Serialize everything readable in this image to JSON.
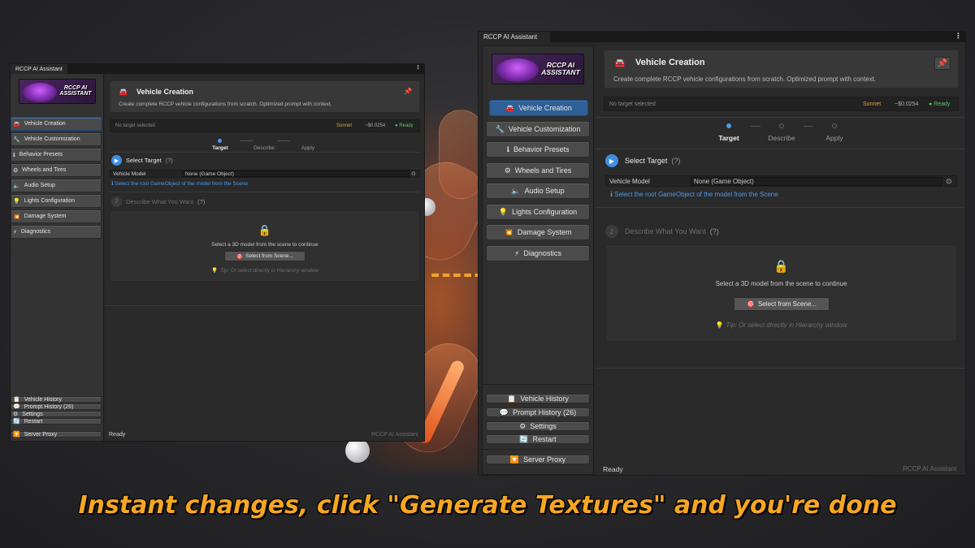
{
  "window": {
    "tab_title": "RCCP AI Assistant",
    "menu_icon": "kebab-menu-icon"
  },
  "logo": {
    "text_line1": "RCCP AI",
    "text_line2": "ASSISTANT"
  },
  "sidebar": {
    "items": [
      {
        "label": "Vehicle Creation",
        "icon": "🚘",
        "active": true
      },
      {
        "label": "Vehicle Customization",
        "icon": "🔧",
        "active": false
      },
      {
        "label": "Behavior Presets",
        "icon": "ℹ",
        "active": false
      },
      {
        "label": "Wheels and Tires",
        "icon": "⚙",
        "active": false
      },
      {
        "label": "Audio Setup",
        "icon": "🔈",
        "active": false
      },
      {
        "label": "Lights Configuration",
        "icon": "💡",
        "active": false
      },
      {
        "label": "Damage System",
        "icon": "💥",
        "active": false
      },
      {
        "label": "Diagnostics",
        "icon": "⚡",
        "active": false
      }
    ],
    "bottom_items": [
      {
        "label": "Vehicle History",
        "icon": "📋"
      },
      {
        "label": "Prompt History (26)",
        "icon": "💬"
      },
      {
        "label": "Settings",
        "icon": "⚙"
      },
      {
        "label": "Restart",
        "icon": "🔄"
      },
      {
        "label": "Server Proxy",
        "icon": "🔽"
      }
    ]
  },
  "header": {
    "title": "Vehicle Creation",
    "icon": "🚘",
    "description": "Create complete RCCP vehicle configurations from scratch. Optimized prompt with context.",
    "pin_icon": "📌"
  },
  "status": {
    "target": "No target selected",
    "model": "Sonnet",
    "price": "~$0.0254",
    "state": "Ready"
  },
  "steps": [
    {
      "label": "Target",
      "active": true
    },
    {
      "label": "Describe",
      "active": false
    },
    {
      "label": "Apply",
      "active": false
    }
  ],
  "section_target": {
    "title": "Select Target",
    "help": "(?)",
    "field_label": "Vehicle Model",
    "field_value": "None (Game Object)",
    "hint": "Select the root GameObject of the model from the Scene"
  },
  "section_describe": {
    "number": "2",
    "title": "Describe What You Want",
    "help": "(?)",
    "lock_icon": "🔒",
    "message": "Select a 3D model from the scene to continue",
    "button_label": "Select from Scene...",
    "button_icon": "🎯",
    "tip": "Tip: Or select directly in Hierarchy window"
  },
  "footer": {
    "status": "Ready",
    "brand": "RCCP AI Assistant"
  },
  "arrow": "------>",
  "caption": "Instant changes, click \"Generate Textures\" and you're done"
}
